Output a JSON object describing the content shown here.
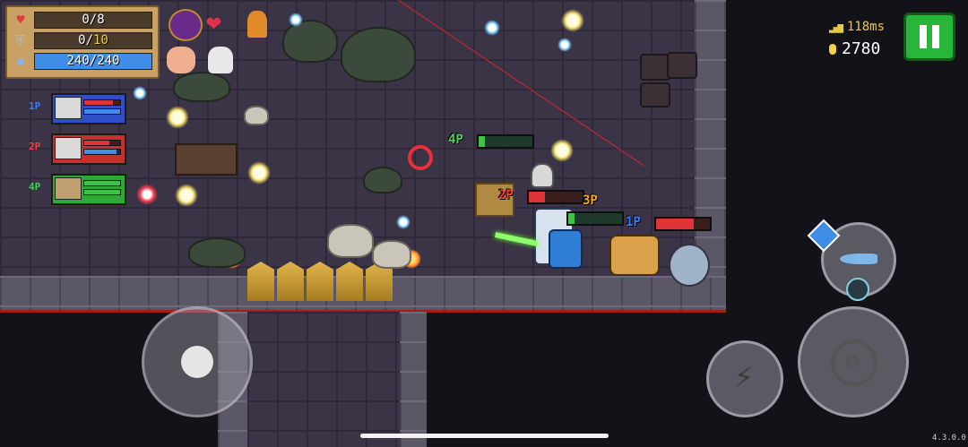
{
  "hud": {
    "hp": "0/8",
    "armor_current": "0",
    "armor_max": "10",
    "energy": "240/240",
    "hp_fraction": 0,
    "armor_fraction": 0,
    "energy_fraction": 1.0
  },
  "status": {
    "ping": "118ms",
    "coins": "2780"
  },
  "players": [
    {
      "tag": "1P",
      "color": "#3b7bff",
      "hp_fraction": 0.8,
      "en_fraction": 1.0
    },
    {
      "tag": "2P",
      "color": "#ff3b3b",
      "hp_fraction": 0.7,
      "en_fraction": 0.9
    },
    {
      "tag": "4P",
      "color": "#3ad54b",
      "hp_fraction": 1.0,
      "en_fraction": 1.0
    }
  ],
  "world_labels": {
    "p4": "4P",
    "p2": "2P",
    "p3": "3P",
    "p1": "1P"
  },
  "weapon": {
    "name_icon": "fish-weapon-icon",
    "swap_icon": "swap-icon"
  },
  "version": "4.3.0.0",
  "colors": {
    "pause_green": "#27b53a",
    "coin_yellow": "#f5d245",
    "energy_blue": "#3f8de6"
  }
}
